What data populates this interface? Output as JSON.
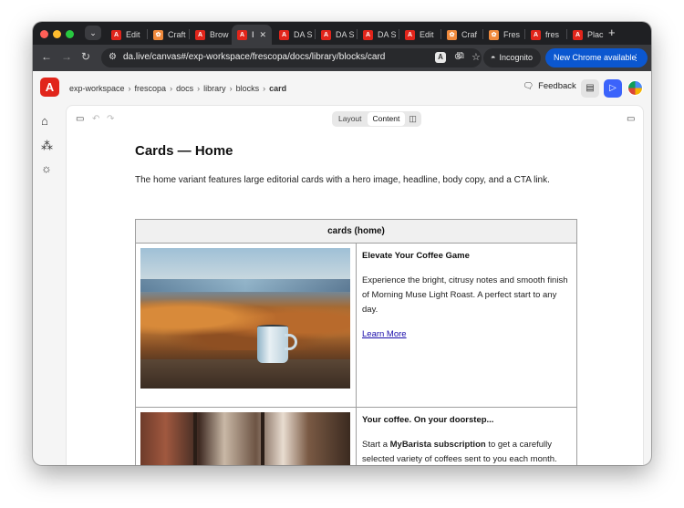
{
  "browser": {
    "tabs": [
      {
        "label": "Edit",
        "favicon": "adobe-icon",
        "active": false
      },
      {
        "label": "Craft",
        "favicon": "craft-icon",
        "active": false
      },
      {
        "label": "Brow",
        "favicon": "adobe-icon",
        "active": false
      },
      {
        "label": "I",
        "favicon": "adobe-icon",
        "active": true
      },
      {
        "label": "DA S",
        "favicon": "adobe-icon",
        "active": false
      },
      {
        "label": "DA S",
        "favicon": "adobe-icon",
        "active": false
      },
      {
        "label": "DA S",
        "favicon": "adobe-icon",
        "active": false
      },
      {
        "label": "Edit",
        "favicon": "adobe-icon",
        "active": false
      },
      {
        "label": "Craf",
        "favicon": "craft-icon",
        "active": false
      },
      {
        "label": "Fres",
        "favicon": "craft-icon",
        "active": false
      },
      {
        "label": "fres",
        "favicon": "adobe-icon",
        "active": false
      },
      {
        "label": "Plac",
        "favicon": "adobe-icon",
        "active": false
      }
    ],
    "url": "da.live/canvas#/exp-workspace/frescopa/docs/library/blocks/card",
    "incognito_label": "Incognito",
    "update_label": "New Chrome available"
  },
  "app": {
    "breadcrumb": [
      "exp-workspace",
      "frescopa",
      "docs",
      "library",
      "blocks",
      "card"
    ],
    "feedback_label": "Feedback"
  },
  "canvas": {
    "view_options": [
      "Layout",
      "Content"
    ],
    "active_view": "Content"
  },
  "document": {
    "title": "Cards — Home",
    "description": "The home variant features large editorial cards with a hero image, headline, body copy, and a CTA link.",
    "block": {
      "name": "cards (home)",
      "cards": [
        {
          "heading": "Elevate Your Coffee Game",
          "body": "Experience the bright, citrusy notes and smooth finish of Morning Muse Light Roast. A perfect start to any day.",
          "link": "Learn More"
        },
        {
          "heading": "Your coffee. On your doorstep...",
          "body_prefix": "Start a ",
          "body_strong": "MyBarista subscription",
          "body_suffix": " to get a carefully selected variety of coffees sent to you each month."
        }
      ]
    }
  }
}
